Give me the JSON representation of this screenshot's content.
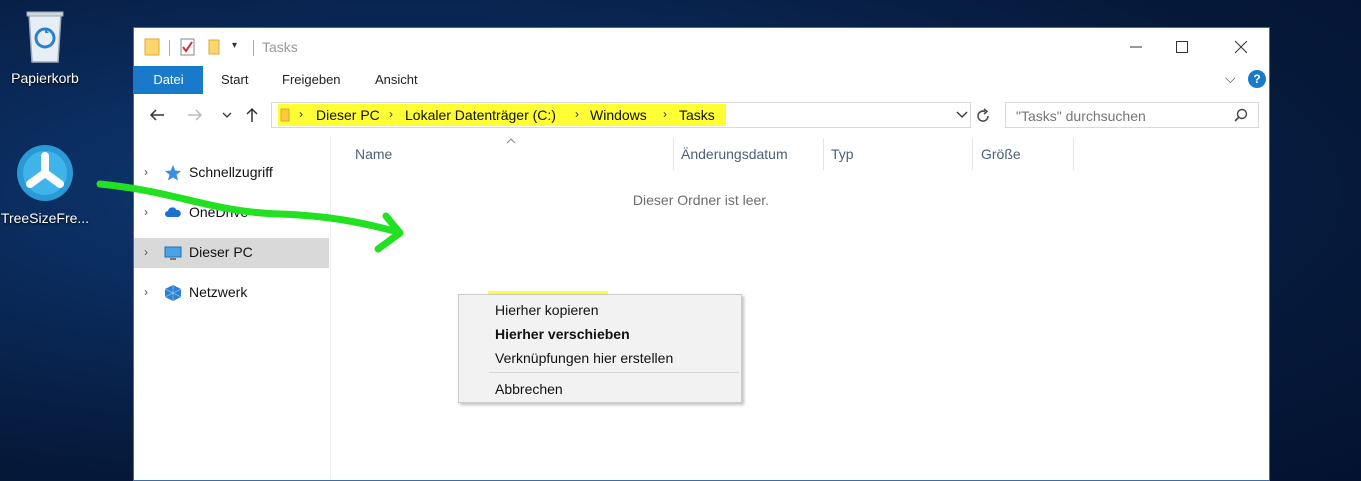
{
  "desktop": {
    "icons": [
      {
        "name": "recycle-bin",
        "label": "Papierkorb"
      },
      {
        "name": "treesize",
        "label": "TreeSizeFre..."
      }
    ]
  },
  "window": {
    "title": "Tasks",
    "ribbon_tabs": [
      "Datei",
      "Start",
      "Freigeben",
      "Ansicht"
    ],
    "address": {
      "crumbs": [
        "Dieser PC",
        "Lokaler Datenträger (C:)",
        "Windows",
        "Tasks"
      ]
    },
    "search": {
      "placeholder": "\"Tasks\" durchsuchen"
    },
    "nav": [
      {
        "label": "Schnellzugriff",
        "selected": false,
        "icon": "star-icon"
      },
      {
        "label": "OneDrive",
        "selected": false,
        "icon": "cloud-icon"
      },
      {
        "label": "Dieser PC",
        "selected": true,
        "icon": "pc-icon"
      },
      {
        "label": "Netzwerk",
        "selected": false,
        "icon": "network-icon"
      }
    ],
    "columns": [
      "Name",
      "Änderungsdatum",
      "Typ",
      "Größe"
    ],
    "empty_text": "Dieser Ordner ist leer."
  },
  "context_menu": {
    "items": [
      "Hierher kopieren",
      "Hierher verschieben",
      "Verknüpfungen hier erstellen",
      "Abbrechen"
    ]
  },
  "colors": {
    "highlight": "#ffff33",
    "arrow": "#22e022",
    "accent": "#1979ca"
  }
}
